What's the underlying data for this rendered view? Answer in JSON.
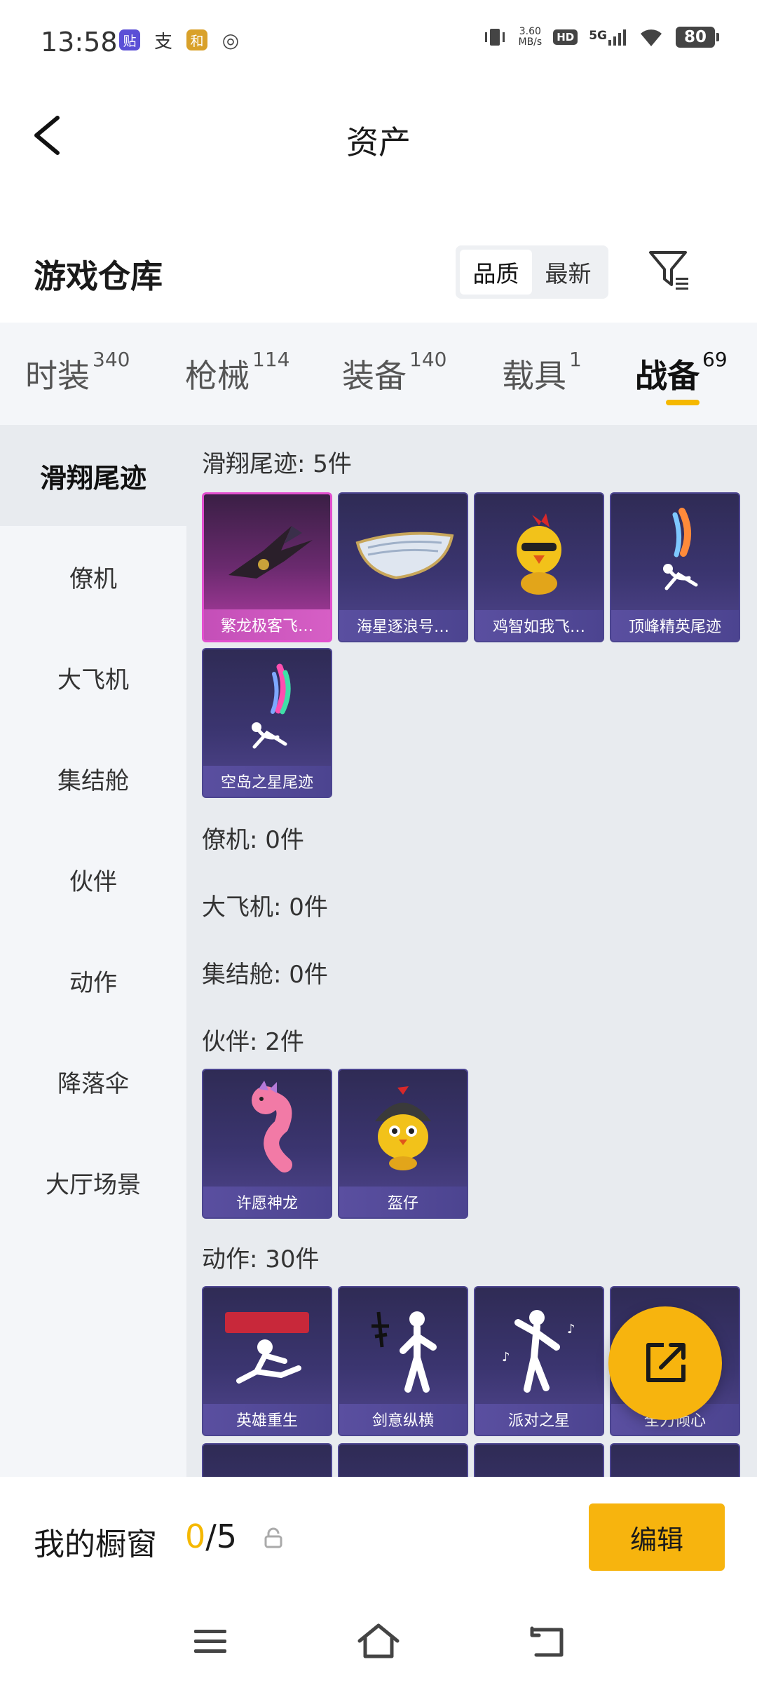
{
  "status_bar": {
    "time": "13:58",
    "app_icons": [
      "贴",
      "支",
      "和",
      "◎"
    ],
    "net_speed_value": "3.60",
    "net_speed_unit": "MB/s",
    "hd_badge": "HD",
    "network": "5G",
    "battery": "80"
  },
  "header": {
    "title": "资产"
  },
  "warehouse": {
    "title": "游戏仓库",
    "sort_options": [
      "品质",
      "最新"
    ],
    "active_sort": "品质"
  },
  "tabs": [
    {
      "label": "时装",
      "count": "340"
    },
    {
      "label": "枪械",
      "count": "114"
    },
    {
      "label": "装备",
      "count": "140"
    },
    {
      "label": "载具",
      "count": "1"
    },
    {
      "label": "战备",
      "count": "69",
      "active": true
    }
  ],
  "side_nav": [
    "滑翔尾迹",
    "僚机",
    "大飞机",
    "集结舱",
    "伙伴",
    "动作",
    "降落伞",
    "大厅场景"
  ],
  "sections": {
    "glide": {
      "title": "滑翔尾迹: 5件",
      "items": [
        "繁龙极客飞…",
        "海星逐浪号…",
        "鸡智如我飞…",
        "顶峰精英尾迹",
        "空岛之星尾迹"
      ]
    },
    "wingman": {
      "title": "僚机: 0件"
    },
    "bigplane": {
      "title": "大飞机: 0件"
    },
    "pod": {
      "title": "集结舱: 0件"
    },
    "partner": {
      "title": "伙伴: 2件",
      "items": [
        "许愿神龙",
        "盔仔"
      ]
    },
    "emote": {
      "title": "动作: 30件",
      "items": [
        "英雄重生",
        "剑意纵横",
        "派对之星",
        "全力倾心"
      ]
    }
  },
  "bottom_bar": {
    "label": "我的橱窗",
    "current": "0",
    "total": "/5",
    "edit_label": "编辑"
  },
  "colors": {
    "accent": "#f7b40e",
    "card_bg": "#3b3570",
    "card_highlight": "#e24fcf"
  }
}
